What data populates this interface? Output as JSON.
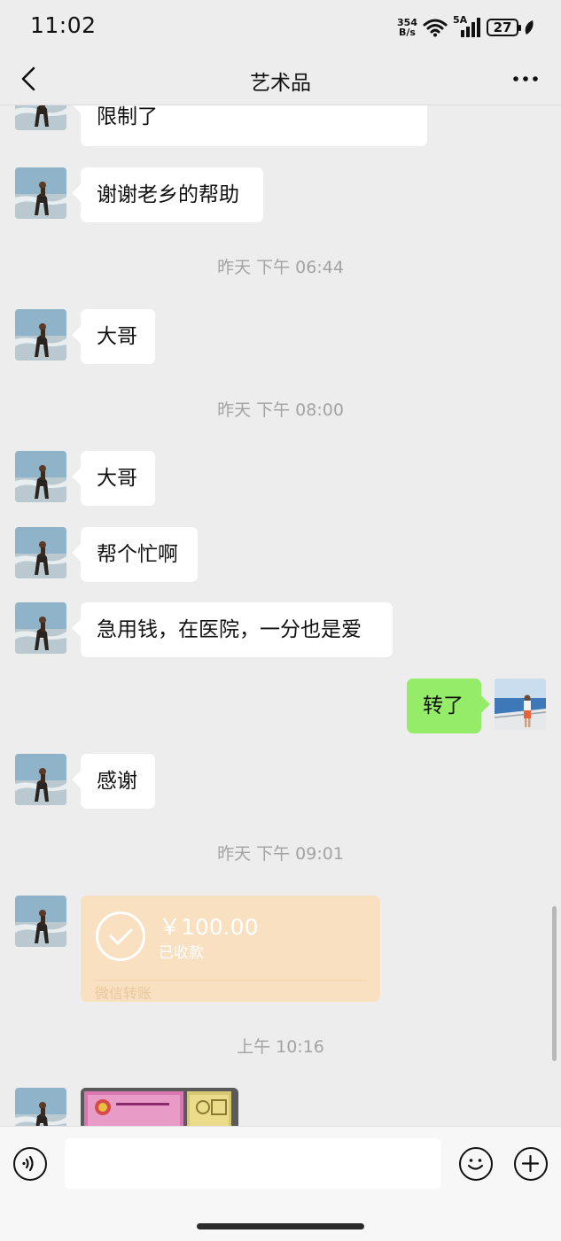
{
  "status_bar": {
    "time": "11:02",
    "net_speed_value": "354",
    "net_speed_unit": "B/s",
    "network_type": "5A",
    "battery": "27"
  },
  "header": {
    "title": "艺术品"
  },
  "messages": [
    {
      "side": "left",
      "text": "限制了"
    },
    {
      "side": "left",
      "text": "谢谢老乡的帮助"
    },
    {
      "timestamp": "昨天 下午 06:44"
    },
    {
      "side": "left",
      "text": "大哥"
    },
    {
      "timestamp": "昨天 下午 08:00"
    },
    {
      "side": "left",
      "text": "大哥"
    },
    {
      "side": "left",
      "text": "帮个忙啊"
    },
    {
      "side": "left",
      "text": "急用钱，在医院，一分也是爱"
    },
    {
      "side": "right",
      "text": "转了"
    },
    {
      "side": "left",
      "text": "感谢"
    },
    {
      "timestamp": "昨天 下午 09:01"
    },
    {
      "side": "left",
      "type": "transfer",
      "amount": "￥100.00",
      "status": "已收款",
      "footer": "微信转账"
    },
    {
      "timestamp": "上午 10:16"
    },
    {
      "side": "left",
      "type": "image"
    }
  ],
  "input": {
    "placeholder": ""
  },
  "colors": {
    "background": "#ededed",
    "own_bubble": "#95ec69",
    "other_bubble": "#ffffff",
    "transfer_card": "#f8e0c0"
  }
}
